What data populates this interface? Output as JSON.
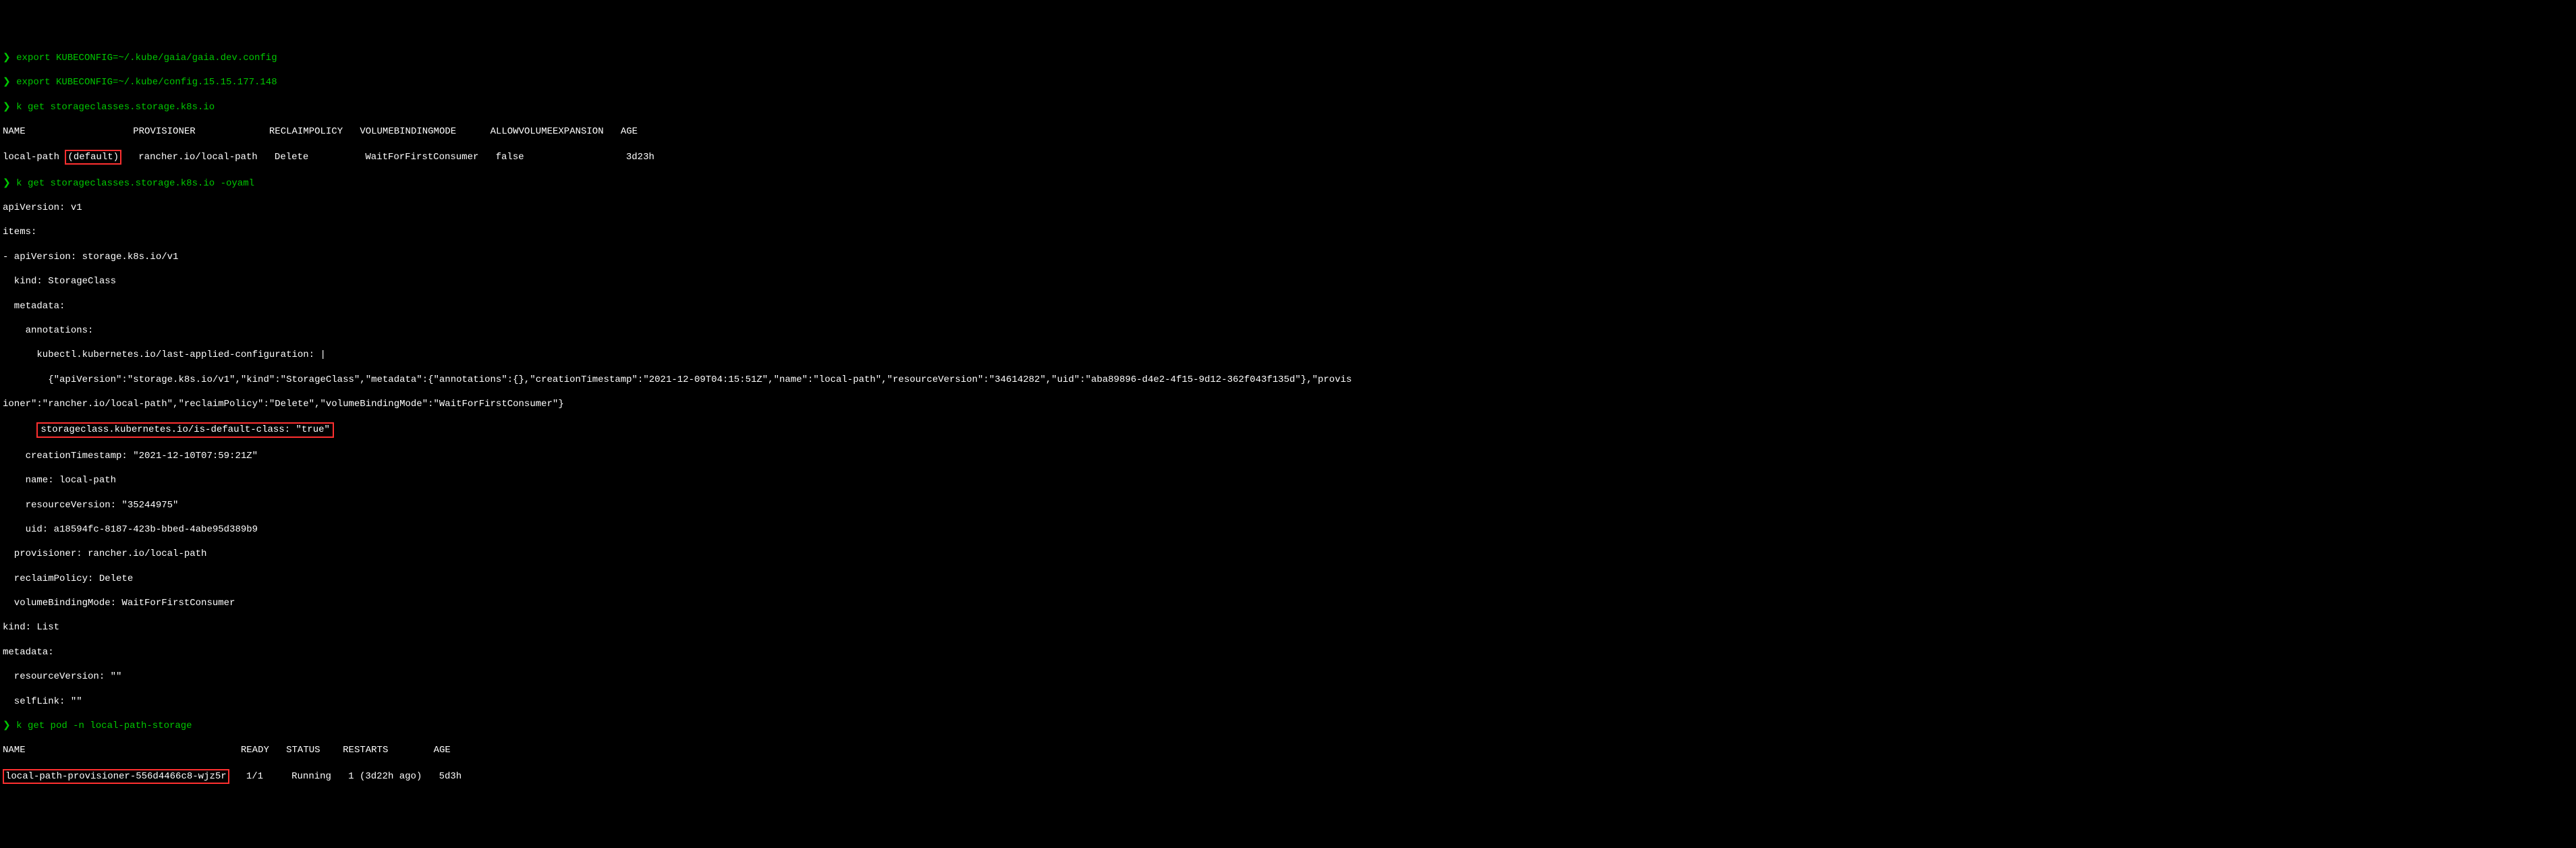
{
  "prompt_char": "❯",
  "commands": {
    "export1": "export KUBECONFIG=~/.kube/gaia/gaia.dev.config",
    "export2": "export KUBECONFIG=~/.kube/config.15.15.177.148",
    "get_sc": "k get storageclasses.storage.k8s.io",
    "get_sc_yaml": "k get storageclasses.storage.k8s.io -oyaml",
    "get_pod": "k get pod -n local-path-storage"
  },
  "sc_table": {
    "headers": {
      "name": "NAME",
      "provisioner": "PROVISIONER",
      "reclaim": "RECLAIMPOLICY",
      "volumebinding": "VOLUMEBINDINGMODE",
      "allowexpansion": "ALLOWVOLUMEEXPANSION",
      "age": "AGE"
    },
    "row": {
      "name_prefix": "local-path ",
      "default_tag": "(default)",
      "provisioner": "rancher.io/local-path",
      "reclaim": "Delete",
      "volumebinding": "WaitForFirstConsumer",
      "allowexpansion": "false",
      "age": "3d23h"
    }
  },
  "yaml": {
    "apiVersion": "apiVersion: v1",
    "items": "items:",
    "item_api": "- apiVersion: storage.k8s.io/v1",
    "kind_sc": "  kind: StorageClass",
    "metadata": "  metadata:",
    "annotations": "    annotations:",
    "last_applied_key": "      kubectl.kubernetes.io/last-applied-configuration: |",
    "last_applied_val": "        {\"apiVersion\":\"storage.k8s.io/v1\",\"kind\":\"StorageClass\",\"metadata\":{\"annotations\":{},\"creationTimestamp\":\"2021-12-09T04:15:51Z\",\"name\":\"local-path\",\"resourceVersion\":\"34614282\",\"uid\":\"aba89896-d4e2-4f15-9d12-362f043f135d\"},\"provis",
    "last_applied_val2": "ioner\":\"rancher.io/local-path\",\"reclaimPolicy\":\"Delete\",\"volumeBindingMode\":\"WaitForFirstConsumer\"}",
    "is_default": "storageclass.kubernetes.io/is-default-class: \"true\"",
    "creation_ts": "    creationTimestamp: \"2021-12-10T07:59:21Z\"",
    "name": "    name: local-path",
    "resource_version": "    resourceVersion: \"35244975\"",
    "uid": "    uid: a18594fc-8187-423b-bbed-4abe95d389b9",
    "provisioner": "  provisioner: rancher.io/local-path",
    "reclaim_policy": "  reclaimPolicy: Delete",
    "volume_binding": "  volumeBindingMode: WaitForFirstConsumer",
    "kind_list": "kind: List",
    "metadata2": "metadata:",
    "resource_version2": "  resourceVersion: \"\"",
    "self_link": "  selfLink: \"\""
  },
  "pod_table": {
    "headers": {
      "name": "NAME",
      "ready": "READY",
      "status": "STATUS",
      "restarts": "RESTARTS",
      "age": "AGE"
    },
    "row": {
      "name": "local-path-provisioner-556d4466c8-wjz5r",
      "ready": "1/1",
      "status": "Running",
      "restarts": "1 (3d22h ago)",
      "age": "5d3h"
    }
  }
}
